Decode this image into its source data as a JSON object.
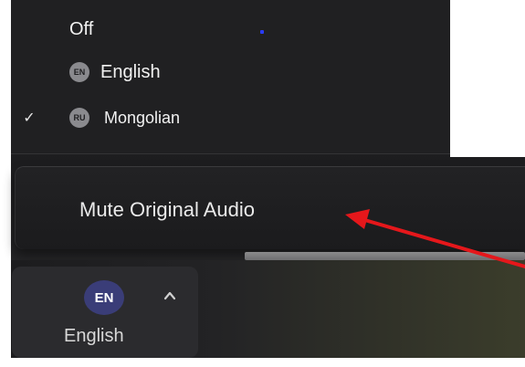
{
  "language_menu": {
    "items": [
      {
        "label": "Off",
        "badge": "",
        "checked": false
      },
      {
        "label": "English",
        "badge": "EN",
        "checked": false
      },
      {
        "label": "Mongolian",
        "badge": "RU",
        "checked": true
      }
    ],
    "check_glyph": "✓"
  },
  "audio_options": {
    "mute_label": "Mute Original Audio"
  },
  "interpretation_button": {
    "badge": "EN",
    "label": "English",
    "caret_icon": "chevron-up-icon"
  },
  "colors": {
    "menu_bg": "#202022",
    "badge_blue": "#3a3d78",
    "annotation_arrow": "#e5171b"
  }
}
